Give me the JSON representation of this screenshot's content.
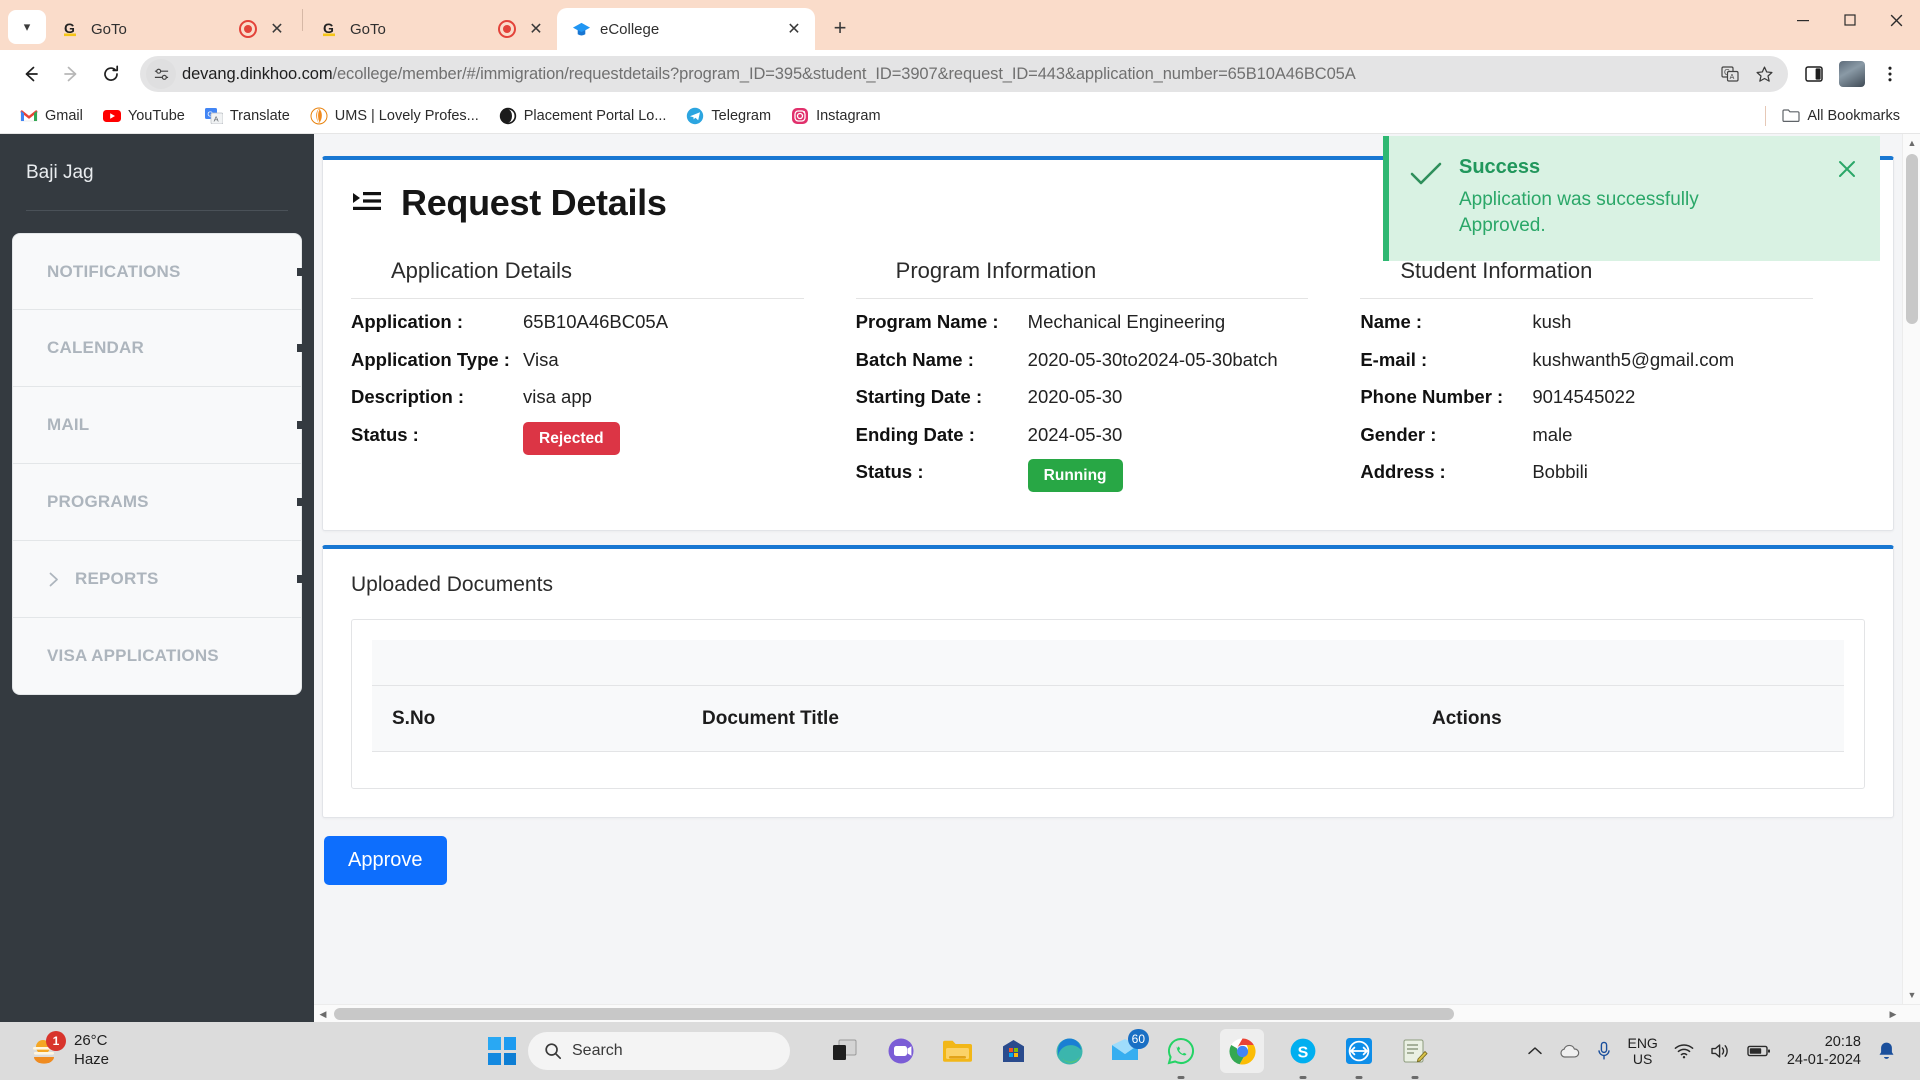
{
  "browser": {
    "tabs": [
      {
        "title": "GoTo",
        "favicon": "goto-icon",
        "recording": true,
        "active": false
      },
      {
        "title": "GoTo",
        "favicon": "goto-icon",
        "recording": true,
        "active": false
      },
      {
        "title": "eCollege",
        "favicon": "ecollege-icon",
        "recording": false,
        "active": true
      }
    ],
    "new_tab_label": "+",
    "window_controls": {
      "minimize": "—",
      "maximize": "☐",
      "close": "✕"
    },
    "nav": {
      "back": "←",
      "forward": "→",
      "reload": "⟳"
    },
    "omnibox": {
      "url_host": "devang.dinkhoo.com",
      "url_path": "/ecollege/member/#/immigration/requestdetails?program_ID=395&student_ID=3907&request_ID=443&application_number=65B10A46BC05A",
      "site_settings_icon": "tune-icon",
      "translate_icon": "translate-icon",
      "bookmark_icon": "star-icon"
    },
    "toolbar_right": {
      "sidepanel_icon": "side-panel-icon",
      "profile_icon": "avatar",
      "menu_icon": "kebab-menu-icon"
    },
    "bookmarks": [
      {
        "label": "Gmail",
        "icon": "gmail-icon"
      },
      {
        "label": "YouTube",
        "icon": "youtube-icon"
      },
      {
        "label": "Translate",
        "icon": "google-translate-icon"
      },
      {
        "label": "UMS | Lovely Profes...",
        "icon": "ums-icon"
      },
      {
        "label": "Placement Portal Lo...",
        "icon": "placement-icon"
      },
      {
        "label": "Telegram",
        "icon": "telegram-icon"
      },
      {
        "label": "Instagram",
        "icon": "instagram-icon"
      }
    ],
    "all_bookmarks_label": "All Bookmarks"
  },
  "sidebar": {
    "user": "Baji Jag",
    "items": [
      {
        "label": "NOTIFICATIONS",
        "expandable": false
      },
      {
        "label": "CALENDAR",
        "expandable": false
      },
      {
        "label": "MAIL",
        "expandable": false
      },
      {
        "label": "PROGRAMS",
        "expandable": false
      },
      {
        "label": "REPORTS",
        "expandable": true
      },
      {
        "label": "VISA APPLICATIONS",
        "expandable": false
      }
    ]
  },
  "page": {
    "title": "Request Details",
    "title_icon": "list-detail-icon",
    "application": {
      "heading": "Application Details",
      "rows": [
        {
          "label": "Application :",
          "value": "65B10A46BC05A",
          "type": "text"
        },
        {
          "label": "Application Type :",
          "value": "Visa",
          "type": "text"
        },
        {
          "label": "Description :",
          "value": "visa app",
          "type": "text"
        },
        {
          "label": "Status :",
          "value": "Rejected",
          "type": "badge",
          "badge_class": "rejected"
        }
      ]
    },
    "program": {
      "heading": "Program Information",
      "rows": [
        {
          "label": "Program Name :",
          "value": "Mechanical Engineering",
          "type": "text"
        },
        {
          "label": "Batch Name :",
          "value": "2020-05-30to2024-05-30batch",
          "type": "text"
        },
        {
          "label": "Starting Date :",
          "value": "2020-05-30",
          "type": "text"
        },
        {
          "label": "Ending Date :",
          "value": "2024-05-30",
          "type": "text"
        },
        {
          "label": "Status :",
          "value": "Running",
          "type": "badge",
          "badge_class": "running"
        }
      ]
    },
    "student": {
      "heading": "Student Information",
      "rows": [
        {
          "label": "Name :",
          "value": "kush",
          "type": "text"
        },
        {
          "label": "E-mail :",
          "value": "kushwanth5@gmail.com",
          "type": "text"
        },
        {
          "label": "Phone Number :",
          "value": "9014545022",
          "type": "text"
        },
        {
          "label": "Gender :",
          "value": "male",
          "type": "text"
        },
        {
          "label": "Address :",
          "value": "Bobbili",
          "type": "text"
        }
      ]
    },
    "documents": {
      "heading": "Uploaded Documents",
      "columns": [
        "S.No",
        "Document Title",
        "Actions"
      ],
      "rows": []
    },
    "approve_label": "Approve",
    "toast": {
      "heading": "Success",
      "message": "Application was successfully Approved.",
      "check_icon": "check-icon",
      "close_icon": "close-icon",
      "accent": "#2eb872",
      "background": "#d9f2e3"
    }
  },
  "taskbar": {
    "weather": {
      "temperature": "26°C",
      "condition": "Haze",
      "badge": "1",
      "icon": "haze-icon"
    },
    "start_label": "start-button",
    "search_placeholder": "Search",
    "apps": [
      {
        "name": "task-view-icon",
        "running": false
      },
      {
        "name": "teams-icon",
        "running": false
      },
      {
        "name": "file-explorer-icon",
        "running": false
      },
      {
        "name": "microsoft-store-icon",
        "running": false
      },
      {
        "name": "edge-icon",
        "running": false
      },
      {
        "name": "mail-icon",
        "running": false,
        "badge": "60"
      },
      {
        "name": "whatsapp-icon",
        "running": true
      },
      {
        "name": "chrome-icon",
        "running": true,
        "active": true
      },
      {
        "name": "skype-icon",
        "running": true
      },
      {
        "name": "teamviewer-icon",
        "running": true
      },
      {
        "name": "notepad-icon",
        "running": true
      }
    ],
    "tray": {
      "chevron": "show-hidden-icons",
      "onedrive": "onedrive-icon",
      "mic": "microphone-icon",
      "language_line1": "ENG",
      "language_line2": "US",
      "wifi": "wifi-icon",
      "volume": "volume-icon",
      "battery": "battery-icon",
      "time": "20:18",
      "date": "24-01-2024",
      "notification": "notification-bell-icon"
    }
  }
}
